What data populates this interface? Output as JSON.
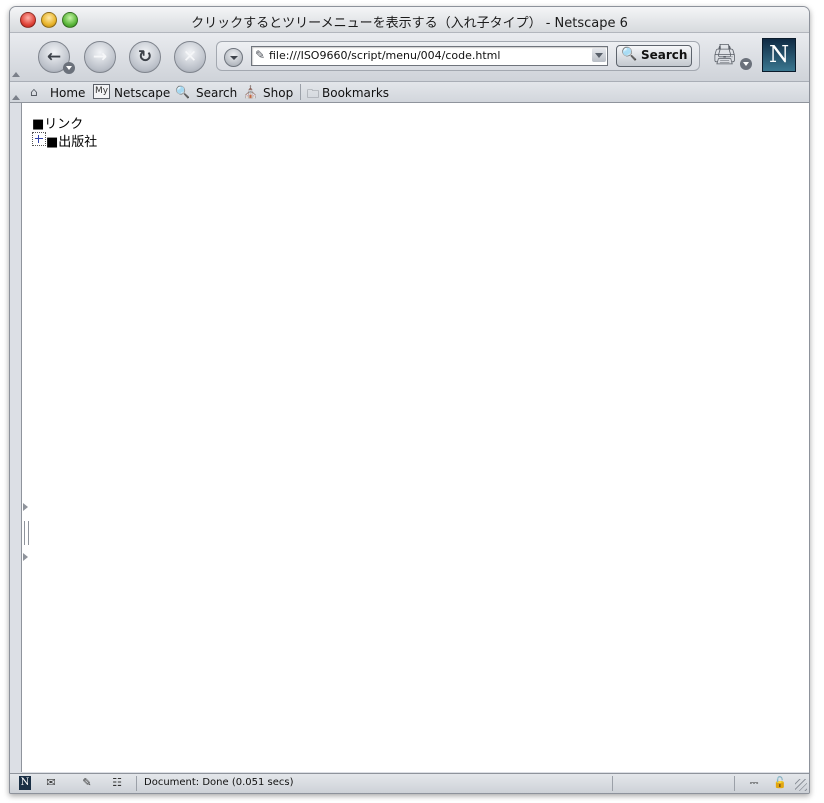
{
  "window": {
    "title": "クリックするとツリーメニューを表示する（入れ子タイプ） - Netscape 6"
  },
  "navbar": {
    "back_icon": "back-arrow-icon",
    "forward_icon": "forward-arrow-icon",
    "reload_icon": "reload-icon",
    "stop_icon": "stop-icon",
    "url": "file:///ISO9660/script/menu/004/code.html",
    "search_label": "Search",
    "print_icon": "printer-icon",
    "logo_text": "N"
  },
  "personal_toolbar": {
    "items": [
      {
        "label": "Home",
        "icon": "home-icon"
      },
      {
        "label": "Netscape",
        "icon": "my-netscape-icon"
      },
      {
        "label": "Search",
        "icon": "search-icon"
      },
      {
        "label": "Shop",
        "icon": "shop-icon"
      },
      {
        "label": "Bookmarks",
        "icon": "folder-icon"
      }
    ],
    "my_badge": "My"
  },
  "content": {
    "tree": [
      {
        "label": "■リンク",
        "expandable": false
      },
      {
        "label": "■出版社",
        "expandable": true
      }
    ]
  },
  "status": {
    "text": "Document: Done (0.051 secs)"
  },
  "colors": {
    "window_chrome": "#dcdfe5",
    "page_background": "#ffffff",
    "logo_dark": "#0f2a44"
  }
}
